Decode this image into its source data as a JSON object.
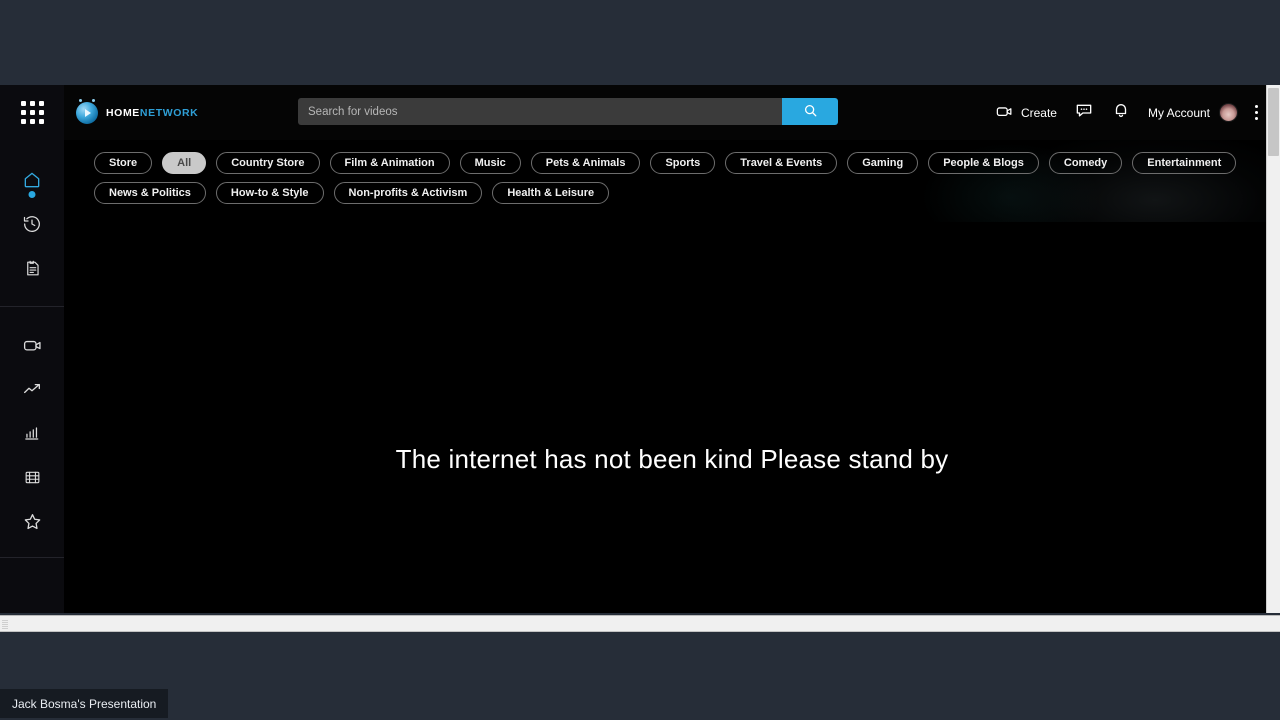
{
  "desktop": {
    "background_color": "#262d38",
    "taskbar_item": "Jack Bosma's Presentation"
  },
  "app": {
    "background_color": "#000000",
    "accent_color": "#29a8e0"
  },
  "sidebar": {
    "apps_grid_icon": "apps-grid-icon",
    "items": [
      {
        "icon": "home-icon",
        "name": "home",
        "active": true
      },
      {
        "icon": "history-clock-icon",
        "name": "history",
        "active": false
      },
      {
        "icon": "playlist-document-icon",
        "name": "playlist",
        "active": false
      },
      {
        "icon": "video-camera-icon",
        "name": "my-videos",
        "active": false
      },
      {
        "icon": "trending-up-icon",
        "name": "trending",
        "active": false
      },
      {
        "icon": "bar-chart-icon",
        "name": "statistics",
        "active": false
      },
      {
        "icon": "film-strip-icon",
        "name": "movies",
        "active": false
      },
      {
        "icon": "star-icon",
        "name": "favorites",
        "active": false
      }
    ]
  },
  "header": {
    "logo": {
      "primary": "HOME",
      "secondary": "NETWORK",
      "mark": "play-circle-logo"
    },
    "search": {
      "placeholder": "Search for videos",
      "value": "",
      "button_icon": "search-icon"
    },
    "actions": {
      "create_label": "Create",
      "create_icon": "video-camera-icon",
      "messages_icon": "message-bubble-icon",
      "notifications_icon": "bell-icon",
      "account_label": "My Account",
      "avatar": "user-avatar",
      "overflow_icon": "kebab-menu-icon"
    }
  },
  "categories": {
    "active": "All",
    "row1": [
      "Store",
      "All",
      "Country Store",
      "Film & Animation",
      "Music",
      "Pets & Animals",
      "Sports",
      "Travel & Events",
      "Gaming",
      "People & Blogs",
      "Comedy",
      "Entertainment"
    ],
    "row2": [
      "News & Politics",
      "How-to & Style",
      "Non-profits & Activism",
      "Health & Leisure"
    ]
  },
  "stage": {
    "message": "The internet has not been kind Please stand by"
  },
  "scrollbars": {
    "vertical": "vertical-scrollbar",
    "horizontal": "horizontal-scrollbar"
  }
}
